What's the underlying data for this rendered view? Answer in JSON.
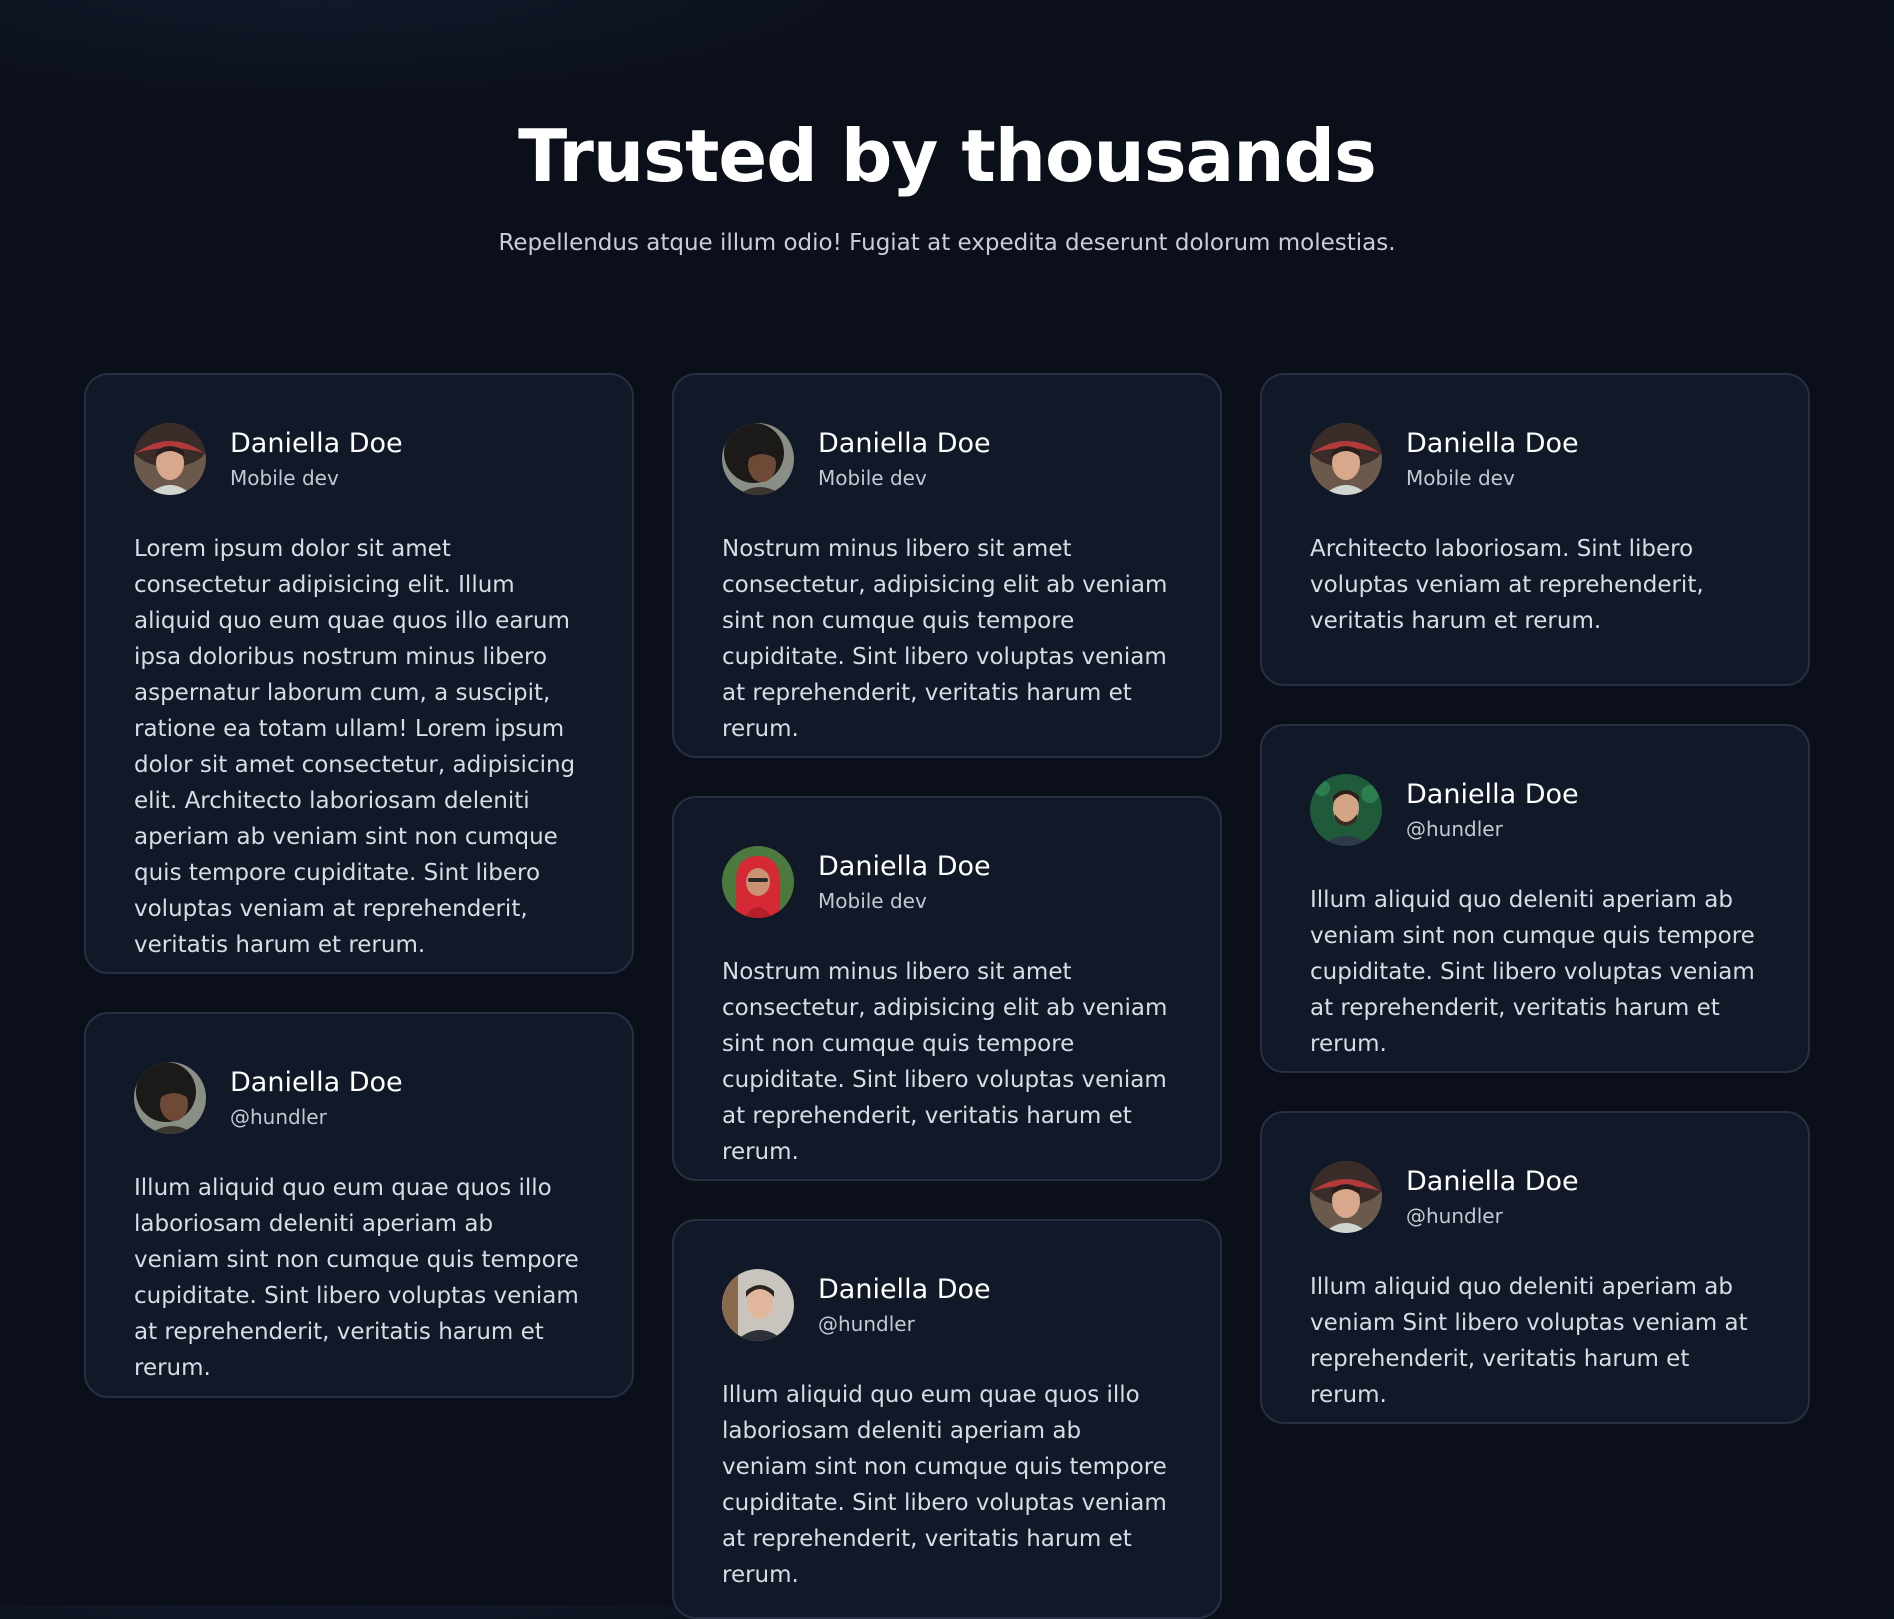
{
  "header": {
    "title": "Trusted by thousands",
    "subtitle": "Repellendus atque illum odio! Fugiat at expedita deserunt dolorum molestias."
  },
  "colors": {
    "background": "#0a0f1a",
    "card": "#111827",
    "card_border": "#273042",
    "heading": "#ffffff",
    "body_text": "#d8dce5"
  },
  "testimonials": [
    {
      "name": "Daniella Doe",
      "role": "Mobile dev",
      "avatar": "woman-with-hat-avatar",
      "quote": "Lorem ipsum dolor sit amet consectetur adipisicing elit. Illum aliquid quo eum quae quos illo earum ipsa doloribus nostrum minus libero aspernatur laborum cum, a suscipit, ratione ea totam ullam! Lorem ipsum dolor sit amet consectetur, adipisicing elit. Architecto laboriosam deleniti aperiam ab veniam sint non cumque quis tempore cupiditate. Sint libero voluptas veniam at reprehenderit, veritatis harum et rerum."
    },
    {
      "name": "Daniella Doe",
      "role": "@hundler",
      "avatar": "woman-dark-hair-avatar",
      "quote": "Illum aliquid quo eum quae quos illo laboriosam deleniti aperiam ab veniam sint non cumque quis tempore cupiditate. Sint libero voluptas veniam at reprehenderit, veritatis harum et rerum."
    },
    {
      "name": "Daniella Doe",
      "role": "Mobile dev",
      "avatar": "woman-dark-hair-avatar",
      "quote": "Nostrum minus libero sit amet consectetur, adipisicing elit ab veniam sint non cumque quis tempore cupiditate. Sint libero voluptas veniam at reprehenderit, veritatis harum et rerum."
    },
    {
      "name": "Daniella Doe",
      "role": "Mobile dev",
      "avatar": "woman-red-hijab-avatar",
      "quote": "Nostrum minus libero sit amet consectetur, adipisicing elit ab veniam sint non cumque quis tempore cupiditate. Sint libero voluptas veniam at reprehenderit, veritatis harum et rerum."
    },
    {
      "name": "Daniella Doe",
      "role": "@hundler",
      "avatar": "man-short-hair-avatar",
      "quote": "Illum aliquid quo eum quae quos illo laboriosam deleniti aperiam ab veniam sint non cumque quis tempore cupiditate. Sint libero voluptas veniam at reprehenderit, veritatis harum et rerum."
    },
    {
      "name": "Daniella Doe",
      "role": "Mobile dev",
      "avatar": "woman-with-hat-avatar",
      "quote": "Architecto laboriosam. Sint libero voluptas veniam at reprehenderit, veritatis harum et rerum."
    },
    {
      "name": "Daniella Doe",
      "role": "@hundler",
      "avatar": "man-with-beard-avatar",
      "quote": "Illum aliquid quo deleniti aperiam ab veniam sint non cumque quis tempore cupiditate. Sint libero voluptas veniam at reprehenderit, veritatis harum et rerum."
    },
    {
      "name": "Daniella Doe",
      "role": "@hundler",
      "avatar": "woman-with-hat-avatar",
      "quote": "Illum aliquid quo deleniti aperiam ab veniam Sint libero voluptas veniam at reprehenderit, veritatis harum et rerum."
    }
  ]
}
